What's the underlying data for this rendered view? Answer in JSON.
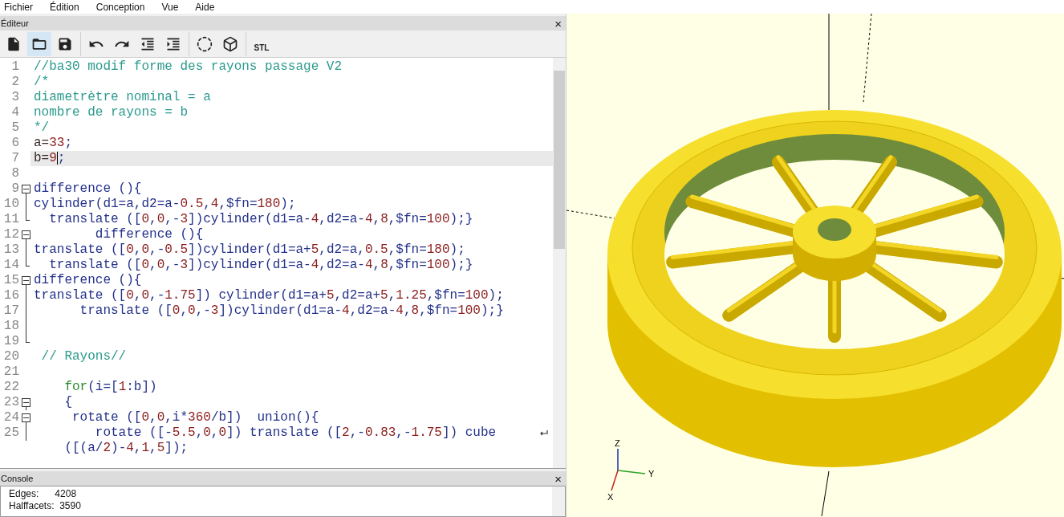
{
  "menu": [
    "Fichier",
    "Édition",
    "Conception",
    "Vue",
    "Aide"
  ],
  "editor": {
    "title": "Éditeur",
    "close": "×",
    "toolbar": [
      [
        {
          "kind": "new",
          "selected": false
        },
        {
          "kind": "open",
          "selected": true
        },
        {
          "kind": "save",
          "selected": false
        }
      ],
      [
        {
          "kind": "undo",
          "selected": false
        },
        {
          "kind": "redo",
          "selected": false
        },
        {
          "kind": "unindent",
          "selected": false
        },
        {
          "kind": "indent",
          "selected": false
        }
      ],
      [
        {
          "kind": "preview",
          "selected": false
        },
        {
          "kind": "render",
          "selected": false
        }
      ],
      [
        {
          "kind": "export",
          "selected": false,
          "label": "STL"
        }
      ]
    ],
    "lines": [
      {
        "num": "1",
        "kind": "plain",
        "tokens": [
          {
            "kind": "comment",
            "text": "//ba30 modif forme des rayons passage V2"
          }
        ]
      },
      {
        "num": "2",
        "kind": "plain",
        "tokens": [
          {
            "kind": "comment",
            "text": "/*"
          }
        ]
      },
      {
        "num": "3",
        "kind": "plain",
        "tokens": [
          {
            "kind": "comment",
            "text": "diametrètre nominal = a"
          }
        ]
      },
      {
        "num": "4",
        "kind": "plain",
        "tokens": [
          {
            "kind": "comment",
            "text": "nombre de rayons = b"
          }
        ]
      },
      {
        "num": "5",
        "kind": "plain",
        "tokens": [
          {
            "kind": "comment",
            "text": "*/"
          }
        ]
      },
      {
        "num": "6",
        "kind": "plain",
        "current": false,
        "tokens": [
          {
            "kind": "var",
            "text": "a="
          },
          {
            "kind": "number",
            "text": "33"
          },
          {
            "kind": "code",
            "text": ";"
          }
        ]
      },
      {
        "num": "7",
        "kind": "plain",
        "current": true,
        "tokens": [
          {
            "kind": "var",
            "text": "b="
          },
          {
            "kind": "number",
            "text": "9",
            "caret": true
          },
          {
            "kind": "code",
            "text": ";"
          }
        ]
      },
      {
        "num": "8",
        "kind": "plain"
      },
      {
        "num": "9",
        "kind": "fold_start",
        "tokens": [
          {
            "kind": "code",
            "text": "difference (){"
          }
        ]
      },
      {
        "num": "10",
        "kind": "fold_body",
        "tokens": [
          {
            "kind": "code",
            "text": "cylinder(d1=a,d2=a-"
          },
          {
            "kind": "number",
            "text": "0.5"
          },
          {
            "kind": "code",
            "text": ","
          },
          {
            "kind": "number",
            "text": "4"
          },
          {
            "kind": "code",
            "text": ",$fn="
          },
          {
            "kind": "number",
            "text": "180"
          },
          {
            "kind": "code",
            "text": ");"
          }
        ]
      },
      {
        "num": "11",
        "kind": "fold_end",
        "tokens": [
          {
            "kind": "code",
            "text": "  translate (["
          },
          {
            "kind": "number",
            "text": "0"
          },
          {
            "kind": "code",
            "text": ","
          },
          {
            "kind": "number",
            "text": "0"
          },
          {
            "kind": "code",
            "text": ",-"
          },
          {
            "kind": "number",
            "text": "3"
          },
          {
            "kind": "code",
            "text": "])cylinder(d1=a-"
          },
          {
            "kind": "number",
            "text": "4"
          },
          {
            "kind": "code",
            "text": ",d2=a-"
          },
          {
            "kind": "number",
            "text": "4"
          },
          {
            "kind": "code",
            "text": ","
          },
          {
            "kind": "number",
            "text": "8"
          },
          {
            "kind": "code",
            "text": ",$fn="
          },
          {
            "kind": "number",
            "text": "100"
          },
          {
            "kind": "code",
            "text": ");}"
          }
        ]
      },
      {
        "num": "12",
        "kind": "fold_start",
        "tokens": [
          {
            "kind": "code",
            "text": "        difference (){"
          }
        ]
      },
      {
        "num": "13",
        "kind": "fold_body",
        "tokens": [
          {
            "kind": "code",
            "text": "translate (["
          },
          {
            "kind": "number",
            "text": "0"
          },
          {
            "kind": "code",
            "text": ","
          },
          {
            "kind": "number",
            "text": "0"
          },
          {
            "kind": "code",
            "text": ",-"
          },
          {
            "kind": "number",
            "text": "0.5"
          },
          {
            "kind": "code",
            "text": "])cylinder(d1=a+"
          },
          {
            "kind": "number",
            "text": "5"
          },
          {
            "kind": "code",
            "text": ",d2=a,"
          },
          {
            "kind": "number",
            "text": "0.5"
          },
          {
            "kind": "code",
            "text": ",$fn="
          },
          {
            "kind": "number",
            "text": "180"
          },
          {
            "kind": "code",
            "text": ");"
          }
        ]
      },
      {
        "num": "14",
        "kind": "fold_end",
        "tokens": [
          {
            "kind": "code",
            "text": "  translate (["
          },
          {
            "kind": "number",
            "text": "0"
          },
          {
            "kind": "code",
            "text": ","
          },
          {
            "kind": "number",
            "text": "0"
          },
          {
            "kind": "code",
            "text": ",-"
          },
          {
            "kind": "number",
            "text": "3"
          },
          {
            "kind": "code",
            "text": "])cylinder(d1=a-"
          },
          {
            "kind": "number",
            "text": "4"
          },
          {
            "kind": "code",
            "text": ",d2=a-"
          },
          {
            "kind": "number",
            "text": "4"
          },
          {
            "kind": "code",
            "text": ","
          },
          {
            "kind": "number",
            "text": "8"
          },
          {
            "kind": "code",
            "text": ",$fn="
          },
          {
            "kind": "number",
            "text": "100"
          },
          {
            "kind": "code",
            "text": ");}"
          }
        ]
      },
      {
        "num": "15",
        "kind": "fold_start",
        "tokens": [
          {
            "kind": "code",
            "text": "difference (){"
          }
        ]
      },
      {
        "num": "16",
        "kind": "fold_body",
        "tokens": [
          {
            "kind": "code",
            "text": "translate (["
          },
          {
            "kind": "number",
            "text": "0"
          },
          {
            "kind": "code",
            "text": ","
          },
          {
            "kind": "number",
            "text": "0"
          },
          {
            "kind": "code",
            "text": ",-"
          },
          {
            "kind": "number",
            "text": "1.75"
          },
          {
            "kind": "code",
            "text": "]) cylinder(d1=a+"
          },
          {
            "kind": "number",
            "text": "5"
          },
          {
            "kind": "code",
            "text": ",d2=a+"
          },
          {
            "kind": "number",
            "text": "5"
          },
          {
            "kind": "code",
            "text": ","
          },
          {
            "kind": "number",
            "text": "1.25"
          },
          {
            "kind": "code",
            "text": ",$fn="
          },
          {
            "kind": "number",
            "text": "100"
          },
          {
            "kind": "code",
            "text": ");"
          }
        ]
      },
      {
        "num": "17",
        "kind": "fold_body",
        "tokens": [
          {
            "kind": "code",
            "text": "      translate (["
          },
          {
            "kind": "number",
            "text": "0"
          },
          {
            "kind": "code",
            "text": ","
          },
          {
            "kind": "number",
            "text": "0"
          },
          {
            "kind": "code",
            "text": ",-"
          },
          {
            "kind": "number",
            "text": "3"
          },
          {
            "kind": "code",
            "text": "])cylinder(d1=a-"
          },
          {
            "kind": "number",
            "text": "4"
          },
          {
            "kind": "code",
            "text": ",d2=a-"
          },
          {
            "kind": "number",
            "text": "4"
          },
          {
            "kind": "code",
            "text": ","
          },
          {
            "kind": "number",
            "text": "8"
          },
          {
            "kind": "code",
            "text": ",$fn="
          },
          {
            "kind": "number",
            "text": "100"
          },
          {
            "kind": "code",
            "text": ");}"
          }
        ]
      },
      {
        "num": "18",
        "kind": "fold_body"
      },
      {
        "num": "19",
        "kind": "fold_end"
      },
      {
        "num": "20",
        "kind": "plain",
        "tokens": [
          {
            "kind": "comment",
            "text": " // Rayons//"
          }
        ]
      },
      {
        "num": "21",
        "kind": "plain"
      },
      {
        "num": "22",
        "kind": "plain",
        "tokens": [
          {
            "kind": "keyword",
            "text": "    for"
          },
          {
            "kind": "code",
            "text": "(i=["
          },
          {
            "kind": "number",
            "text": "1"
          },
          {
            "kind": "code",
            "text": ":b])"
          }
        ]
      },
      {
        "num": "23",
        "kind": "fold_start",
        "tokens": [
          {
            "kind": "code",
            "text": "    {"
          }
        ]
      },
      {
        "num": "24",
        "kind": "fold_start",
        "tokens": [
          {
            "kind": "code",
            "text": "     rotate (["
          },
          {
            "kind": "number",
            "text": "0"
          },
          {
            "kind": "code",
            "text": ","
          },
          {
            "kind": "number",
            "text": "0"
          },
          {
            "kind": "code",
            "text": ",i*"
          },
          {
            "kind": "number",
            "text": "360"
          },
          {
            "kind": "code",
            "text": "/b])  union(){"
          }
        ]
      },
      {
        "num": "25",
        "kind": "fold_body",
        "tokens": [
          {
            "kind": "code",
            "text": "        rotate ([-"
          },
          {
            "kind": "number",
            "text": "5.5"
          },
          {
            "kind": "code",
            "text": ","
          },
          {
            "kind": "number",
            "text": "0"
          },
          {
            "kind": "code",
            "text": ","
          },
          {
            "kind": "number",
            "text": "0"
          },
          {
            "kind": "code",
            "text": "]) translate (["
          },
          {
            "kind": "number",
            "text": "2"
          },
          {
            "kind": "code",
            "text": ",-"
          },
          {
            "kind": "number",
            "text": "0.83"
          },
          {
            "kind": "code",
            "text": ",-"
          },
          {
            "kind": "number",
            "text": "1.75"
          },
          {
            "kind": "code",
            "text": "]) cube"
          }
        ],
        "continuation": {
          "tokens": [
            {
              "kind": "code",
              "text": "    ([(a/"
            },
            {
              "kind": "number",
              "text": "2"
            },
            {
              "kind": "code",
              "text": ")-"
            },
            {
              "kind": "number",
              "text": "4"
            },
            {
              "kind": "code",
              "text": ","
            },
            {
              "kind": "number",
              "text": "1"
            },
            {
              "kind": "code",
              "text": ","
            },
            {
              "kind": "number",
              "text": "5"
            },
            {
              "kind": "code",
              "text": "]);"
            }
          ]
        }
      }
    ]
  },
  "console": {
    "title": "Console",
    "close": "×",
    "lines": [
      "Edges:      4208",
      "Halffacets:  3590"
    ]
  },
  "viewer": {
    "axes": {
      "z": "Z",
      "y": "Y",
      "x": "X"
    }
  }
}
